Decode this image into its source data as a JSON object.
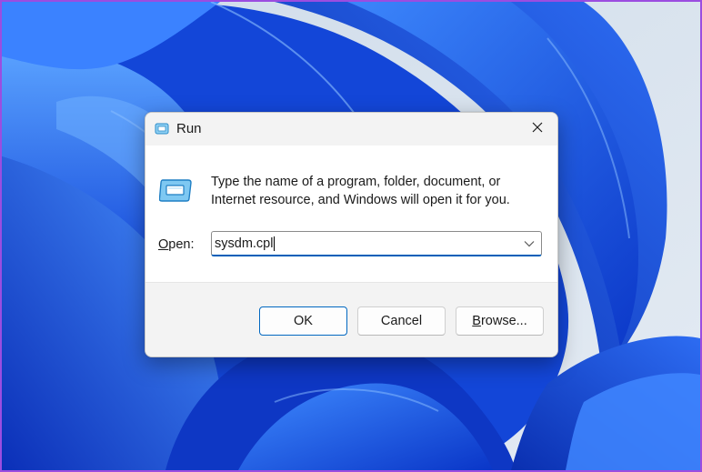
{
  "window": {
    "title": "Run",
    "title_icon": "run-icon",
    "close_icon": "close-icon"
  },
  "description": {
    "line1": "Type the name of a program, folder, document, or",
    "line2": "Internet resource, and Windows will open it for you."
  },
  "open_field": {
    "label_accel": "O",
    "label_rest": "pen:",
    "value": "sysdm.cpl",
    "dropdown_icon": "chevron-down-icon"
  },
  "buttons": {
    "ok": "OK",
    "cancel": "Cancel",
    "browse_accel": "B",
    "browse_rest": "rowse..."
  },
  "colors": {
    "accent": "#005fb8",
    "wallpaper_primary": "#1e5ce8",
    "wallpaper_background": "#dbe5ef"
  }
}
